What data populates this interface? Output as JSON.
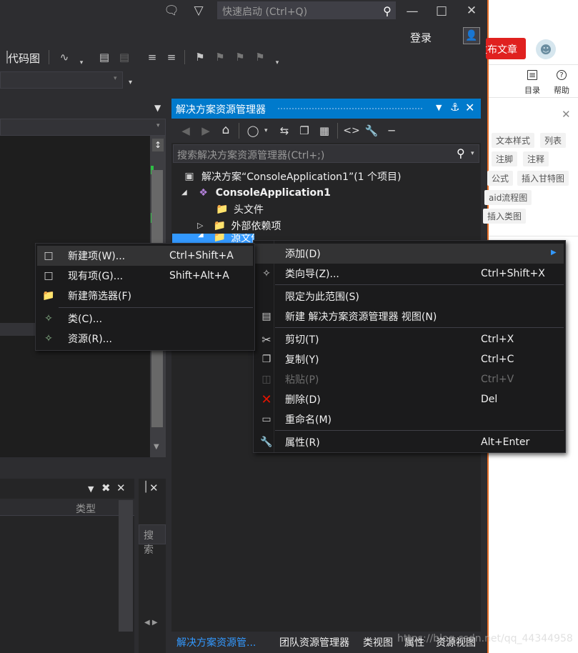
{
  "titlebar": {
    "quick_launch_placeholder": "快速启动 (Ctrl+Q)",
    "login": "登录"
  },
  "toolbar": {
    "code_map": "代码图"
  },
  "browser": {
    "publish": "发布文章",
    "toc": "目录",
    "help": "帮助",
    "tags": [
      "文本样式",
      "列表",
      "注脚",
      "注释",
      "公式",
      "插入甘特图",
      "aid流程图",
      "插入类图"
    ]
  },
  "solution_explorer": {
    "title": "解决方案资源管理器",
    "search_placeholder": "搜索解决方案资源管理器(Ctrl+;)",
    "tree": {
      "solution": "解决方案“ConsoleApplication1”(1 个项目)",
      "project": "ConsoleApplication1",
      "headers": "头文件",
      "external": "外部依赖项",
      "sources": "源文件"
    }
  },
  "context_menu": {
    "items": [
      {
        "label": "添加(D)",
        "shortcut": ""
      },
      {
        "label": "类向导(Z)...",
        "shortcut": "Ctrl+Shift+X"
      },
      {
        "label": "限定为此范围(S)",
        "shortcut": ""
      },
      {
        "label": "新建 解决方案资源管理器 视图(N)",
        "shortcut": ""
      },
      {
        "label": "剪切(T)",
        "shortcut": "Ctrl+X"
      },
      {
        "label": "复制(Y)",
        "shortcut": "Ctrl+C"
      },
      {
        "label": "粘贴(P)",
        "shortcut": "Ctrl+V"
      },
      {
        "label": "删除(D)",
        "shortcut": "Del"
      },
      {
        "label": "重命名(M)",
        "shortcut": ""
      },
      {
        "label": "属性(R)",
        "shortcut": "Alt+Enter"
      }
    ]
  },
  "submenu": {
    "items": [
      {
        "label": "新建项(W)...",
        "shortcut": "Ctrl+Shift+A"
      },
      {
        "label": "现有项(G)...",
        "shortcut": "Shift+Alt+A"
      },
      {
        "label": "新建筛选器(F)",
        "shortcut": ""
      },
      {
        "label": "类(C)...",
        "shortcut": ""
      },
      {
        "label": "资源(R)...",
        "shortcut": ""
      }
    ]
  },
  "lower_panel": {
    "type_col": "类型",
    "search": "搜索"
  },
  "bottom_tabs": [
    "解决方案资源管...",
    "团队资源管理器",
    "类视图",
    "属性",
    "资源视图"
  ],
  "watermark": "https://blog.csdn.net/qq_44344958"
}
